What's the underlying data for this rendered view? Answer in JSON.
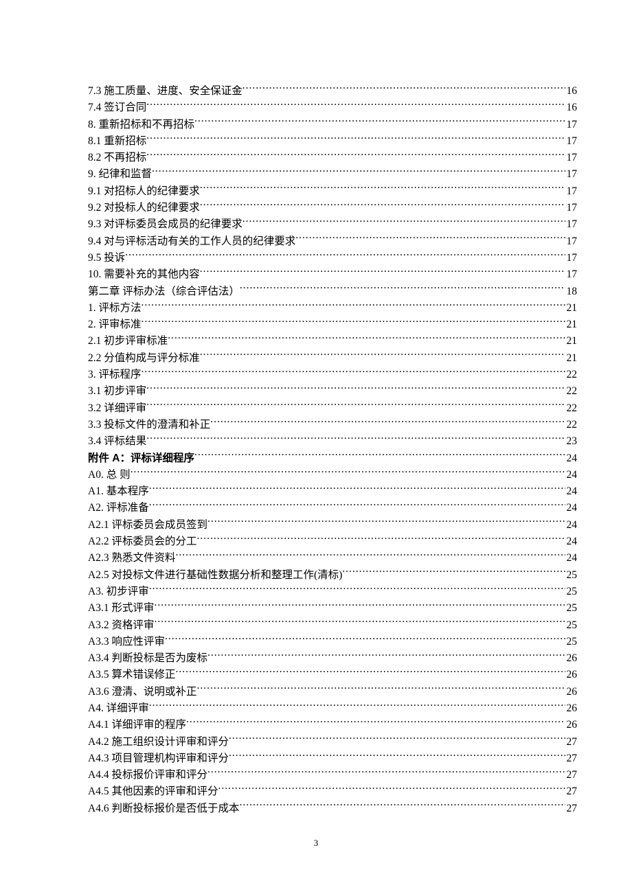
{
  "page_number": "3",
  "toc": [
    {
      "label": "7.3 施工质量、进度、安全保证金",
      "page": "16",
      "bold": false
    },
    {
      "label": "7.4 签订合同",
      "page": "16",
      "bold": false
    },
    {
      "label": "8. 重新招标和不再招标",
      "page": "17",
      "bold": false
    },
    {
      "label": "8.1 重新招标",
      "page": "17",
      "bold": false
    },
    {
      "label": "8.2 不再招标",
      "page": "17",
      "bold": false
    },
    {
      "label": "9. 纪律和监督",
      "page": "17",
      "bold": false
    },
    {
      "label": "9.1 对招标人的纪律要求",
      "page": "17",
      "bold": false
    },
    {
      "label": "9.2 对投标人的纪律要求",
      "page": "17",
      "bold": false
    },
    {
      "label": "9.3 对评标委员会成员的纪律要求",
      "page": "17",
      "bold": false
    },
    {
      "label": "9.4 对与评标活动有关的工作人员的纪律要求",
      "page": "17",
      "bold": false
    },
    {
      "label": "9.5 投诉",
      "page": "17",
      "bold": false
    },
    {
      "label": "10. 需要补充的其他内容",
      "page": "17",
      "bold": false
    },
    {
      "label": "第二章 评标办法（综合评估法）",
      "page": "18",
      "bold": false
    },
    {
      "label": "1. 评标方法",
      "page": "21",
      "bold": false
    },
    {
      "label": "2. 评审标准",
      "page": "21",
      "bold": false
    },
    {
      "label": "2.1 初步评审标准",
      "page": "21",
      "bold": false
    },
    {
      "label": "2.2 分值构成与评分标准",
      "page": "21",
      "bold": false
    },
    {
      "label": "3. 评标程序",
      "page": "22",
      "bold": false
    },
    {
      "label": "3.1 初步评审",
      "page": "22",
      "bold": false
    },
    {
      "label": "3.2 详细评审",
      "page": "22",
      "bold": false
    },
    {
      "label": "3.3 投标文件的澄清和补正",
      "page": "22",
      "bold": false
    },
    {
      "label": "3.4 评标结果",
      "page": "23",
      "bold": false
    },
    {
      "label": "附件 A：评标详细程序",
      "page": "24",
      "bold": true
    },
    {
      "label": "A0. 总  则",
      "page": "24",
      "bold": false
    },
    {
      "label": "A1. 基本程序",
      "page": "24",
      "bold": false
    },
    {
      "label": "A2. 评标准备",
      "page": "24",
      "bold": false
    },
    {
      "label": "A2.1 评标委员会成员签到",
      "page": "24",
      "bold": false
    },
    {
      "label": "A2.2 评标委员会的分工",
      "page": "24",
      "bold": false
    },
    {
      "label": "A2.3 熟悉文件资料",
      "page": "24",
      "bold": false
    },
    {
      "label": "A2.5 对投标文件进行基础性数据分析和整理工作(清标)",
      "page": "25",
      "bold": false
    },
    {
      "label": "A3. 初步评审",
      "page": "25",
      "bold": false
    },
    {
      "label": "A3.1 形式评审",
      "page": "25",
      "bold": false
    },
    {
      "label": "A3.2 资格评审",
      "page": "25",
      "bold": false
    },
    {
      "label": "A3.3 响应性评审",
      "page": "25",
      "bold": false
    },
    {
      "label": "A3.4 判断投标是否为废标",
      "page": "26",
      "bold": false
    },
    {
      "label": "A3.5 算术错误修正",
      "page": "26",
      "bold": false
    },
    {
      "label": "A3.6 澄清、说明或补正",
      "page": "26",
      "bold": false
    },
    {
      "label": "A4. 详细评审",
      "page": "26",
      "bold": false
    },
    {
      "label": "A4.1 详细评审的程序",
      "page": "26",
      "bold": false
    },
    {
      "label": "A4.2 施工组织设计评审和评分",
      "page": "27",
      "bold": false
    },
    {
      "label": "A4.3 项目管理机构评审和评分",
      "page": "27",
      "bold": false
    },
    {
      "label": "A4.4 投标报价评审和评分",
      "page": "27",
      "bold": false
    },
    {
      "label": "A4.5 其他因素的评审和评分",
      "page": "27",
      "bold": false
    },
    {
      "label": "A4.6 判断投标报价是否低于成本",
      "page": "27",
      "bold": false
    }
  ]
}
